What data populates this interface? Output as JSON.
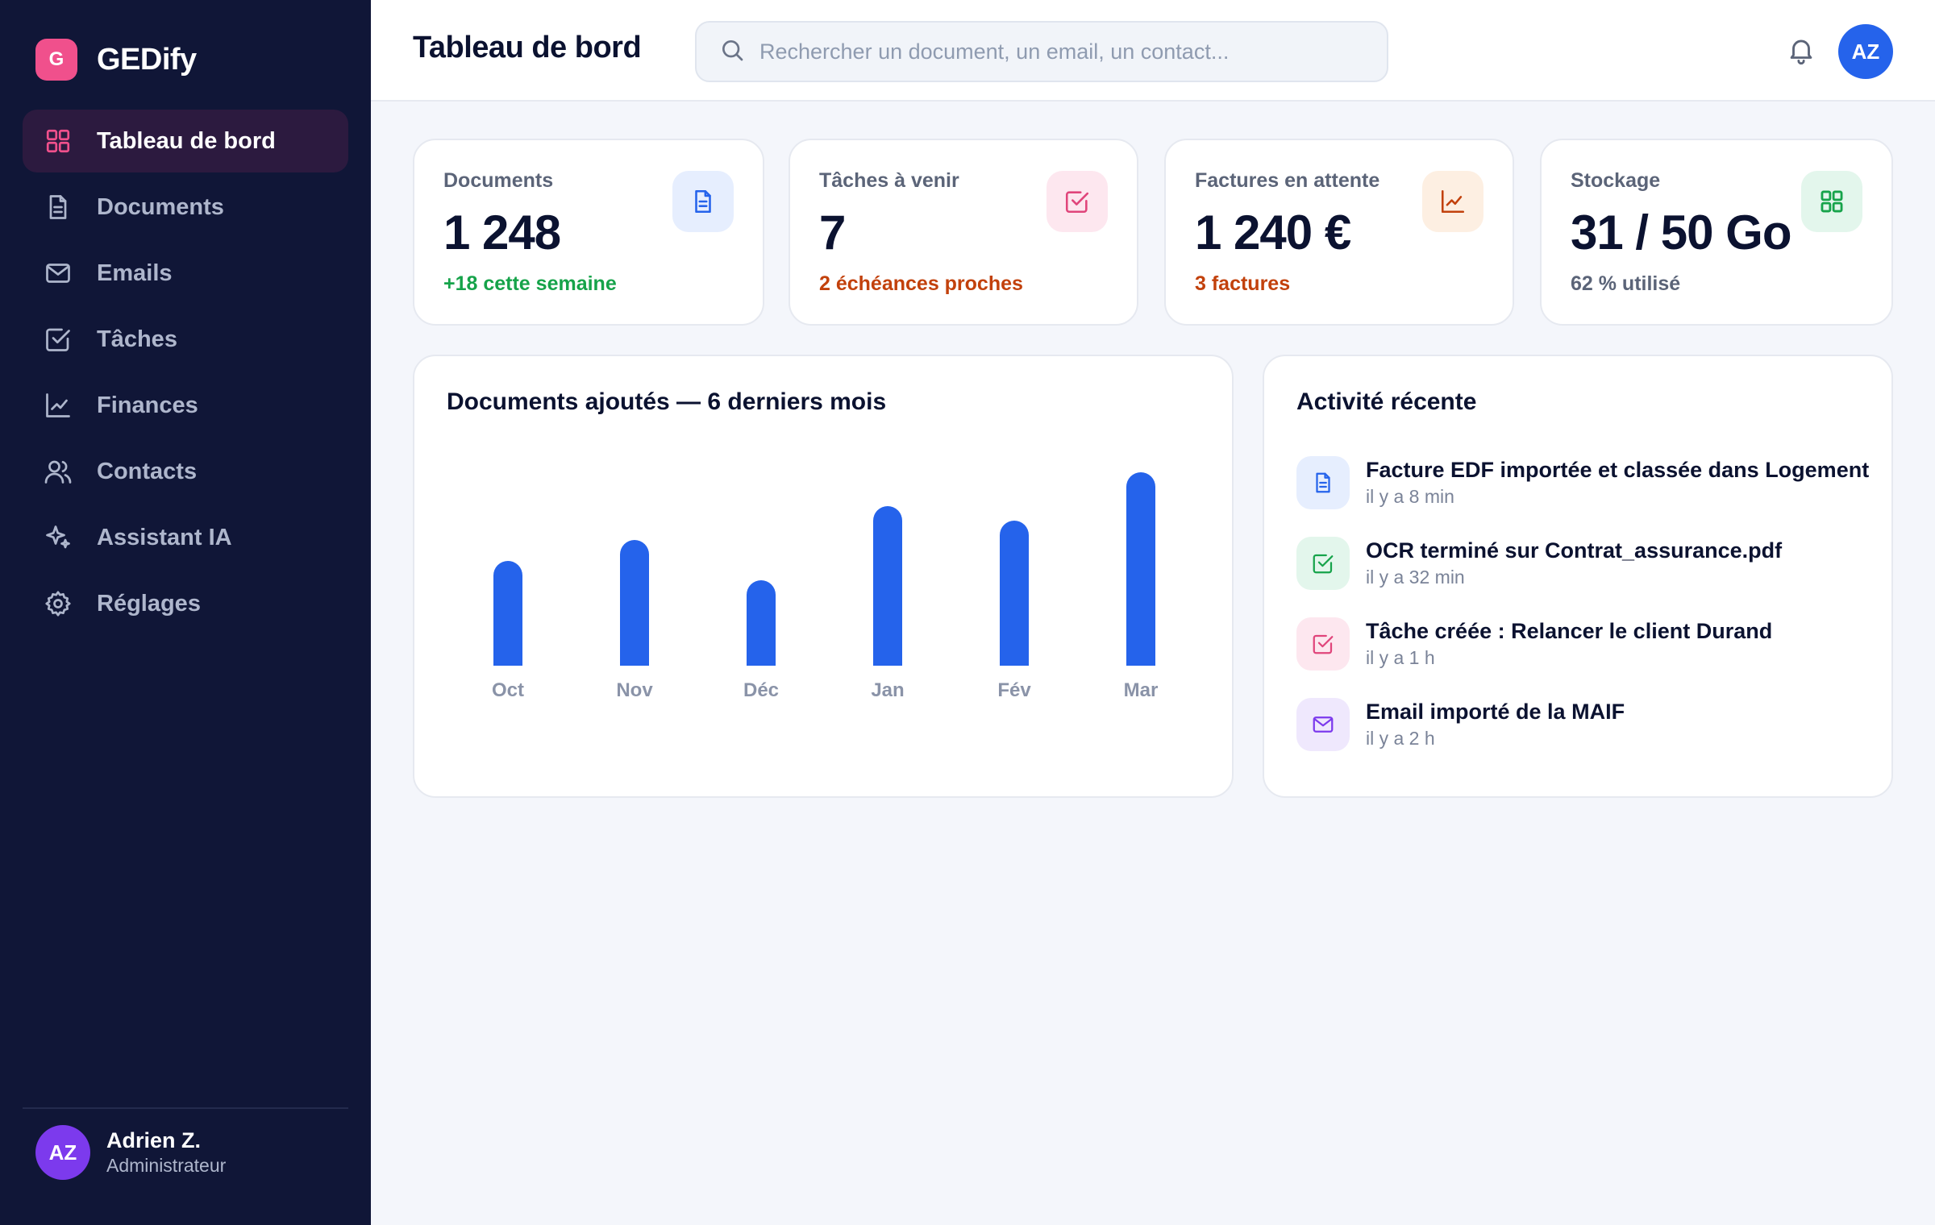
{
  "app": {
    "logo_letter": "G",
    "name": "GEDify"
  },
  "sidebar": {
    "items": [
      {
        "label": "Tableau de bord",
        "icon": "dashboard-icon",
        "active": true
      },
      {
        "label": "Documents",
        "icon": "document-icon",
        "active": false
      },
      {
        "label": "Emails",
        "icon": "mail-icon",
        "active": false
      },
      {
        "label": "Tâches",
        "icon": "task-check-icon",
        "active": false
      },
      {
        "label": "Finances",
        "icon": "chart-line-icon",
        "active": false
      },
      {
        "label": "Contacts",
        "icon": "users-icon",
        "active": false
      },
      {
        "label": "Assistant IA",
        "icon": "sparkle-icon",
        "active": false
      },
      {
        "label": "Réglages",
        "icon": "gear-icon",
        "active": false
      }
    ],
    "user": {
      "initials": "AZ",
      "name": "Adrien Z.",
      "role": "Administrateur"
    }
  },
  "header": {
    "title": "Tableau de bord",
    "search_placeholder": "Rechercher un document, un email, un contact...",
    "avatar_initials": "AZ"
  },
  "stats": [
    {
      "label": "Documents",
      "value": "1 248",
      "sub": "+18 cette semaine",
      "sub_color": "#16a34a",
      "icon": "document-icon",
      "icon_color": "#2563eb",
      "icon_bg": "#e6eefe"
    },
    {
      "label": "Tâches à venir",
      "value": "7",
      "sub": "2 échéances proches",
      "sub_color": "#c2410c",
      "icon": "task-check-icon",
      "icon_color": "#e0457b",
      "icon_bg": "#fde7ef"
    },
    {
      "label": "Factures en attente",
      "value": "1 240 €",
      "sub": "3 factures",
      "sub_color": "#c2410c",
      "icon": "chart-line-icon",
      "icon_color": "#c2410c",
      "icon_bg": "#fdefe2"
    },
    {
      "label": "Stockage",
      "value": "31 / 50 Go",
      "sub": "62 % utilisé",
      "sub_color": "#5b6478",
      "icon": "grid-icon",
      "icon_color": "#16a34a",
      "icon_bg": "#e3f6ec"
    }
  ],
  "chart_data": {
    "type": "bar",
    "title": "Documents ajoutés — 6 derniers mois",
    "categories": [
      "Oct",
      "Nov",
      "Déc",
      "Jan",
      "Fév",
      "Mar"
    ],
    "values": [
      130,
      156,
      106,
      198,
      180,
      240
    ],
    "ylim": [
      0,
      240
    ],
    "color": "#2563eb",
    "grid": false,
    "xlabel": "",
    "ylabel": ""
  },
  "activity": {
    "title": "Activité récente",
    "items": [
      {
        "title": "Facture EDF importée et classée dans Logement",
        "time": "il y a 8 min",
        "icon": "document-icon",
        "icon_color": "#2563eb",
        "icon_bg": "#e6eefe"
      },
      {
        "title": "OCR terminé sur Contrat_assurance.pdf",
        "time": "il y a 32 min",
        "icon": "task-check-icon",
        "icon_color": "#16a34a",
        "icon_bg": "#e3f6ec"
      },
      {
        "title": "Tâche créée : Relancer le client Durand",
        "time": "il y a 1 h",
        "icon": "task-check-icon",
        "icon_color": "#e0457b",
        "icon_bg": "#fde7ef"
      },
      {
        "title": "Email importé de la MAIF",
        "time": "il y a 2 h",
        "icon": "mail-icon",
        "icon_color": "#7c3aed",
        "icon_bg": "#efe8fd"
      }
    ]
  }
}
